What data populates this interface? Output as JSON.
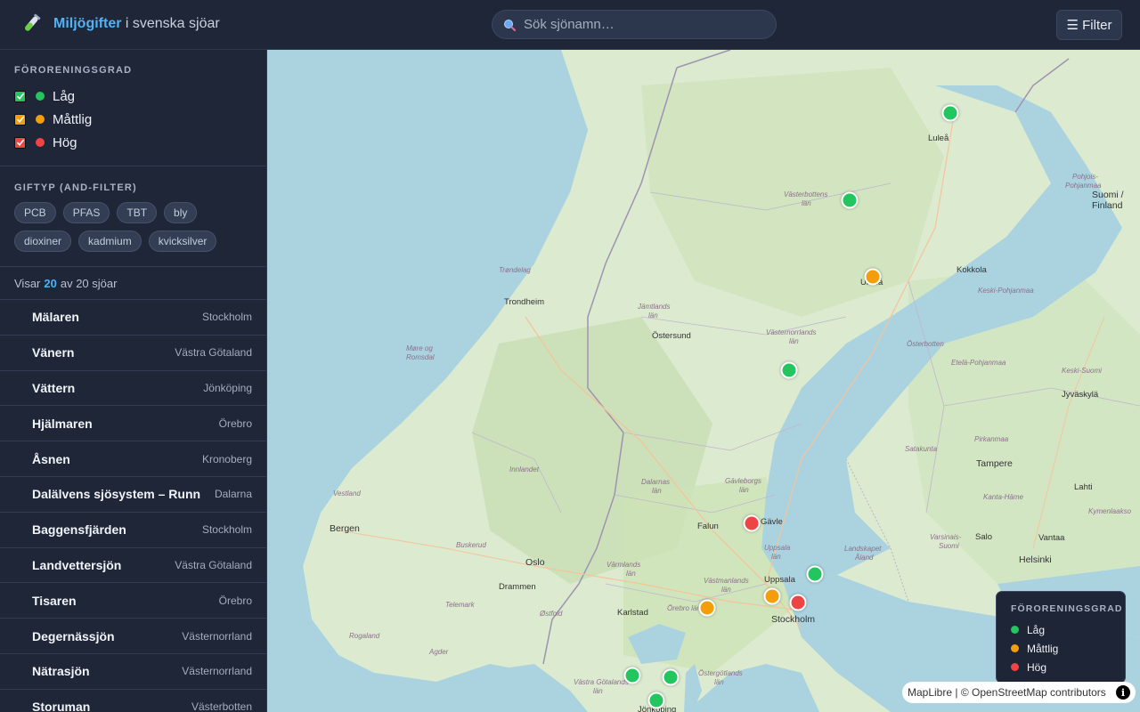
{
  "header": {
    "brand_strong": "Miljögifter",
    "brand_rest": " i svenska sjöar",
    "search_placeholder": "Sök sjönamn…",
    "filter_label": "☰ Filter"
  },
  "sidebar": {
    "levels_title": "FÖRORENINGSGRAD",
    "levels": [
      {
        "label": "Låg",
        "color": "#22c55e"
      },
      {
        "label": "Måttlig",
        "color": "#f59e0b"
      },
      {
        "label": "Hög",
        "color": "#ef4444"
      }
    ],
    "toxins_title": "GIFTYP (AND-FILTER)",
    "toxins": [
      "PCB",
      "PFAS",
      "TBT",
      "bly",
      "dioxiner",
      "kadmium",
      "kvicksilver"
    ],
    "count_prefix": "Visar",
    "count_shown": "20",
    "count_suffix": "av 20 sjöar",
    "lakes": [
      {
        "name": "Mälaren",
        "region": "Stockholm"
      },
      {
        "name": "Vänern",
        "region": "Västra Götaland"
      },
      {
        "name": "Vättern",
        "region": "Jönköping"
      },
      {
        "name": "Hjälmaren",
        "region": "Örebro"
      },
      {
        "name": "Åsnen",
        "region": "Kronoberg"
      },
      {
        "name": "Dalälvens sjösystem – Runn",
        "region": "Dalarna"
      },
      {
        "name": "Baggensfjärden",
        "region": "Stockholm"
      },
      {
        "name": "Landvettersjön",
        "region": "Västra Götaland"
      },
      {
        "name": "Tisaren",
        "region": "Örebro"
      },
      {
        "name": "Degernässjön",
        "region": "Västernorrland"
      },
      {
        "name": "Nätrasjön",
        "region": "Västernorrland"
      },
      {
        "name": "Storuman",
        "region": "Västerbotten"
      }
    ]
  },
  "map": {
    "labels": {
      "lulea": "Luleå",
      "vasterbotten": "Västerbottens",
      "lan1": "län",
      "umea": "Umeå",
      "jamtland": "Jämtlands",
      "lan2": "län",
      "ostersund": "Östersund",
      "vasternorrland": "Västernorrlands",
      "lan3": "län",
      "trondelag": "Trøndelag",
      "trondheim": "Trondheim",
      "more": "Møre og",
      "romsdal": "Romsdal",
      "vestland": "Vestland",
      "bergen": "Bergen",
      "innlandet": "Innlandet",
      "buskerud": "Buskerud",
      "oslo": "Oslo",
      "drammen": "Drammen",
      "telemark": "Telemark",
      "rogaland": "Rogaland",
      "agder": "Agder",
      "ostfold": "Østfold",
      "varmland": "Värmlands",
      "lan4": "län",
      "karlstad": "Karlstad",
      "dalarnas": "Dalarnas",
      "lan5": "län",
      "falun": "Falun",
      "gavleborgs": "Gävleborgs",
      "lan6": "län",
      "gavle": "Gävle",
      "uppsala_lan": "Uppsala",
      "lan7": "län",
      "uppsala": "Uppsala",
      "vastmanlands": "Västmanlands",
      "lan8": "län",
      "orebro": "Örebro län",
      "stockholm": "Stockholm",
      "vastra_gotaland": "Västra Götalands",
      "lan9": "län",
      "ostergotland": "Östergötlands",
      "lan10": "län",
      "jonkoping": "Jönköping",
      "kokkola": "Kokkola",
      "keski": "Keski-Pohjanmaa",
      "pohjois": "Pohjois-",
      "pohjanmaa": "Pohjanmaa",
      "suomi": "Suomi /",
      "finland": "Finland",
      "jyvaskyla": "Jyväskylä",
      "keski_suomi": "Keski-Suomi",
      "etela": "Etelä-Pohjanmaa",
      "osterbotten": "Österbotten",
      "satakunta": "Satakunta",
      "pirkanmaa": "Pirkanmaa",
      "tampere": "Tampere",
      "kanta": "Kanta-Häme",
      "lahti": "Lahti",
      "kymenlaakso": "Kymenlaakso",
      "varsinais": "Varsinais-",
      "suomi2": "Suomi",
      "salo": "Salo",
      "vantaa": "Vantaa",
      "helsinki": "Helsinki",
      "landskapet": "Landskapet",
      "aland": "Åland"
    },
    "markers": [
      {
        "level": "Låg"
      },
      {
        "level": "Låg"
      },
      {
        "level": "Måttlig"
      },
      {
        "level": "Låg"
      },
      {
        "level": "Hög"
      },
      {
        "level": "Låg"
      },
      {
        "level": "Måttlig"
      },
      {
        "level": "Hög"
      },
      {
        "level": "Måttlig"
      },
      {
        "level": "Låg"
      },
      {
        "level": "Låg"
      },
      {
        "level": "Låg"
      }
    ],
    "legend_title": "FÖRORENINGSGRAD",
    "legend": [
      {
        "label": "Låg",
        "color": "#22c55e"
      },
      {
        "label": "Måttlig",
        "color": "#f59e0b"
      },
      {
        "label": "Hög",
        "color": "#ef4444"
      }
    ],
    "attribution_lib": "MapLibre",
    "attribution_sep": " | © ",
    "attribution_osm": "OpenStreetMap",
    "attribution_contrib": " contributors",
    "info_glyph": "i"
  }
}
